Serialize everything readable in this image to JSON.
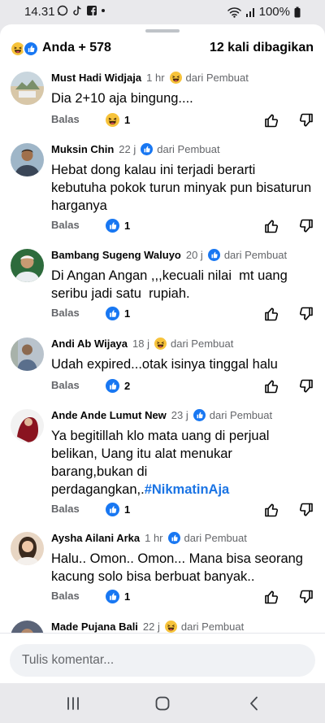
{
  "status": {
    "time": "14.31",
    "battery": "100%",
    "left_icons": [
      "whatsapp-icon",
      "tiktok-icon",
      "facebook-icon",
      "dot-icon"
    ],
    "right_icons": [
      "wifi-icon",
      "signal-icon",
      "battery-icon"
    ]
  },
  "header": {
    "reactions": [
      "haha-icon",
      "like-icon"
    ],
    "count_label": "Anda + 578",
    "shares_label": "12 kali dibagikan"
  },
  "comments": [
    {
      "author": "Must Hadi Widjaja",
      "time": "1 hr",
      "badge_icon": "haha-icon",
      "badge_label": "dari Pembuat",
      "lines": [
        "Dia 2+10 aja bingung...."
      ],
      "reply_label": "Balas",
      "reaction_icon": "haha-icon",
      "reaction_count": "1"
    },
    {
      "author": "Muksin Chin",
      "time": "22 j",
      "badge_icon": "like-icon",
      "badge_label": "dari Pembuat",
      "lines": [
        "Hebat dong kalau ini terjadi berarti",
        "kebutuha pokok turun minyak pun bisaturun",
        "harganya"
      ],
      "reply_label": "Balas",
      "reaction_icon": "like-icon",
      "reaction_count": "1"
    },
    {
      "author": "Bambang Sugeng Waluyo",
      "time": "20 j",
      "badge_icon": "like-icon",
      "badge_label": "dari Pembuat",
      "lines": [
        "Di Angan Angan ,,,kecuali nilai  mt uang",
        "seribu jadi satu  rupiah."
      ],
      "reply_label": "Balas",
      "reaction_icon": "like-icon",
      "reaction_count": "1"
    },
    {
      "author": "Andi Ab Wijaya",
      "time": "18 j",
      "badge_icon": "haha-icon",
      "badge_label": "dari Pembuat",
      "lines": [
        "Udah expired...otak isinya tinggal halu"
      ],
      "reply_label": "Balas",
      "reaction_icon": "like-icon",
      "reaction_count": "2"
    },
    {
      "author": "Ande Ande Lumut New",
      "time": "23 j",
      "badge_icon": "like-icon",
      "badge_label": "dari Pembuat",
      "lines": [
        "Ya begitillah klo mata uang di perjual",
        "belikan, Uang itu alat menukar",
        "barang,bukan di"
      ],
      "last_line_text": "perdagangkan,.",
      "hashtag": "#NikmatinAja",
      "reply_label": "Balas",
      "reaction_icon": "like-icon",
      "reaction_count": "1"
    },
    {
      "author": "Aysha Ailani Arka",
      "time": "1 hr",
      "badge_icon": "like-icon",
      "badge_label": "dari Pembuat",
      "lines": [
        "Halu.. Omon.. Omon... Mana bisa seorang",
        "kacung solo bisa berbuat banyak.."
      ],
      "reply_label": "Balas",
      "reaction_icon": "like-icon",
      "reaction_count": "1"
    },
    {
      "author": "Made Pujana Bali",
      "time": "22 j",
      "badge_icon": "haha-icon",
      "badge_label": "dari Pembuat"
    }
  ],
  "composer": {
    "placeholder": "Tulis komentar..."
  },
  "navbar": {
    "buttons": [
      "recent-apps-icon",
      "home-icon",
      "back-icon"
    ]
  },
  "colors": {
    "like_blue": "#1877f2",
    "haha_yellow": "#f7c33b",
    "hashtag_blue": "#1b74e4",
    "muted": "#65676b"
  }
}
